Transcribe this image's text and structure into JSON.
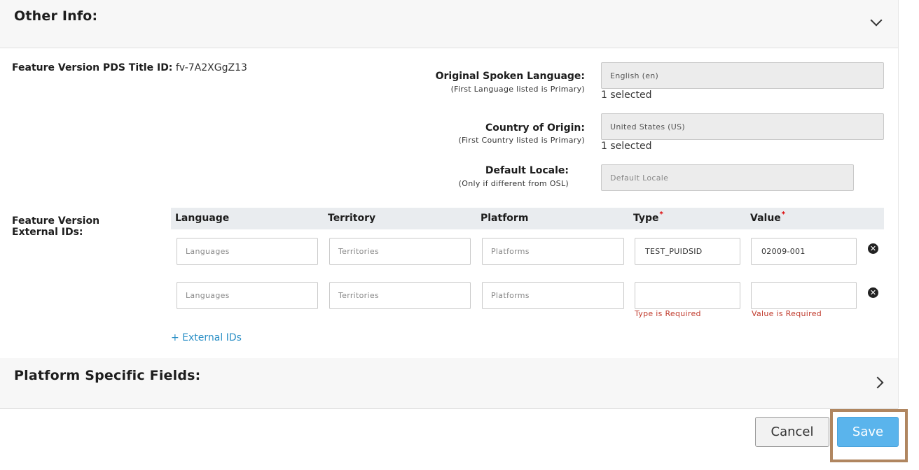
{
  "other_info": {
    "title": "Other Info:"
  },
  "pds": {
    "label": "Feature Version PDS Title ID:",
    "value": "fv-7A2XGgZ13"
  },
  "spoken_language": {
    "label": "Original Spoken Language:",
    "hint": "(First Language listed is Primary)",
    "value": "English (en)",
    "count": "1 selected"
  },
  "country": {
    "label": "Country of Origin:",
    "hint": "(First Country listed is Primary)",
    "value": "United States (US)",
    "count": "1 selected"
  },
  "locale": {
    "label": "Default Locale:",
    "hint": "(Only if different from OSL)",
    "placeholder": "Default Locale"
  },
  "external_ids": {
    "label_line1": "Feature Version",
    "label_line2": "External IDs:",
    "columns": {
      "language": "Language",
      "territory": "Territory",
      "platform": "Platform",
      "type": "Type",
      "value": "Value"
    },
    "required_mark": "*",
    "rows": [
      {
        "language_placeholder": "Languages",
        "territory_placeholder": "Territories",
        "platform_placeholder": "Platforms",
        "type": "TEST_PUIDSID",
        "value": "02009-001"
      },
      {
        "language_placeholder": "Languages",
        "territory_placeholder": "Territories",
        "platform_placeholder": "Platforms",
        "type": "",
        "value": "",
        "type_error": "Type is Required",
        "value_error": "Value is Required"
      }
    ],
    "add_label": "+ External IDs"
  },
  "platform_fields": {
    "title": "Platform Specific Fields:"
  },
  "actions": {
    "cancel": "Cancel",
    "save": "Save"
  }
}
